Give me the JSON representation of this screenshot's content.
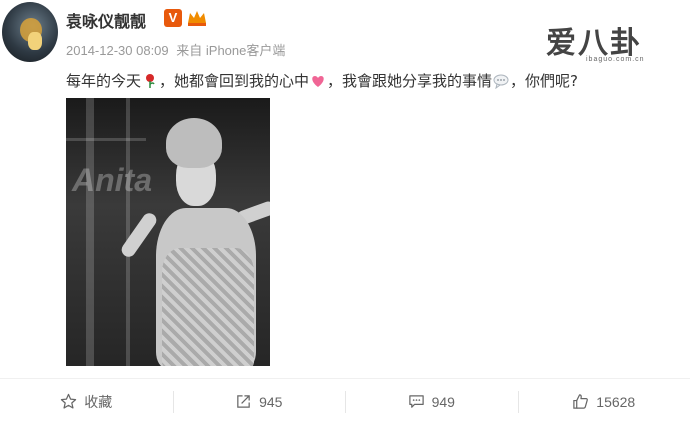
{
  "user": {
    "name": "袁咏仪靓靓",
    "verified_badge": "V",
    "vip_icon": "crown-icon",
    "timestamp": "2014-12-30 08:09",
    "source": "来自 iPhone客户端"
  },
  "watermark": {
    "logo_text": "爱八卦",
    "site": "ibaguo.com.cn"
  },
  "post": {
    "text_part1": "每年的今天",
    "emoji1": "rose-icon",
    "text_part2": "，她都會回到我的心中",
    "emoji2": "heart-icon",
    "text_part3": "，我會跟她分享我的事情",
    "emoji3": "speech-bubble-icon",
    "text_part4": "，你們呢?",
    "photo_watermark": "Anita"
  },
  "actions": {
    "favorite_label": "收藏",
    "repost_count": "945",
    "comment_count": "949",
    "like_count": "15628"
  },
  "colors": {
    "verify_badge": "#e8590c",
    "vip": "#f08c00",
    "meta_gray": "#999999"
  }
}
